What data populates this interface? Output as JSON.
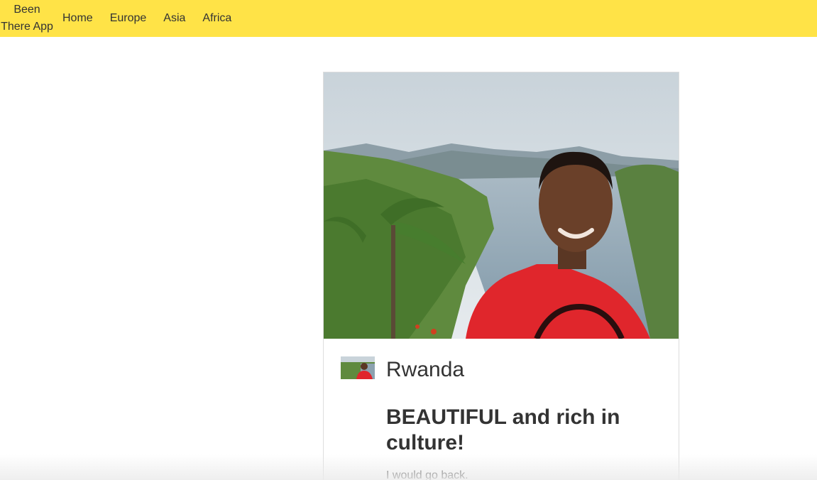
{
  "nav": {
    "brand_line1": "Been",
    "brand_line2": "There App",
    "links": [
      {
        "label": "Home"
      },
      {
        "label": "Europe"
      },
      {
        "label": "Asia"
      },
      {
        "label": "Africa"
      }
    ]
  },
  "card": {
    "image_description": "Man in red shirt smiling in front of lake and hills",
    "title": "Rwanda",
    "headline": "BEAUTIFUL and rich in culture!",
    "body": "I would go back."
  },
  "colors": {
    "navbar_bg": "#ffe347",
    "text": "#333333",
    "card_border": "#dddddd"
  }
}
